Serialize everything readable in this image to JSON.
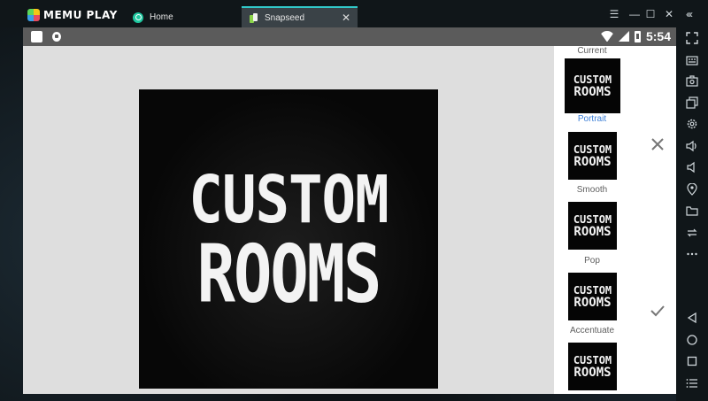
{
  "app": {
    "name": "MEMU PLAY"
  },
  "tabs": [
    {
      "label": "Home"
    },
    {
      "label": "Snapseed"
    }
  ],
  "statusbar": {
    "time": "5:54"
  },
  "image": {
    "line1": "CUSTOM",
    "line2": "ROOMS"
  },
  "filters": [
    {
      "label": "Current",
      "active": false
    },
    {
      "label": "Portrait",
      "active": true
    },
    {
      "label": "Smooth",
      "active": false
    },
    {
      "label": "Pop",
      "active": false
    },
    {
      "label": "Accentuate",
      "active": false
    },
    {
      "label": "",
      "active": false
    }
  ],
  "colors": {
    "accent_teal": "#31c8c8",
    "active_blue": "#3d7fd6",
    "arrow_red": "#e02020"
  },
  "icons": {
    "cancel": "close-icon",
    "apply": "check-icon"
  }
}
